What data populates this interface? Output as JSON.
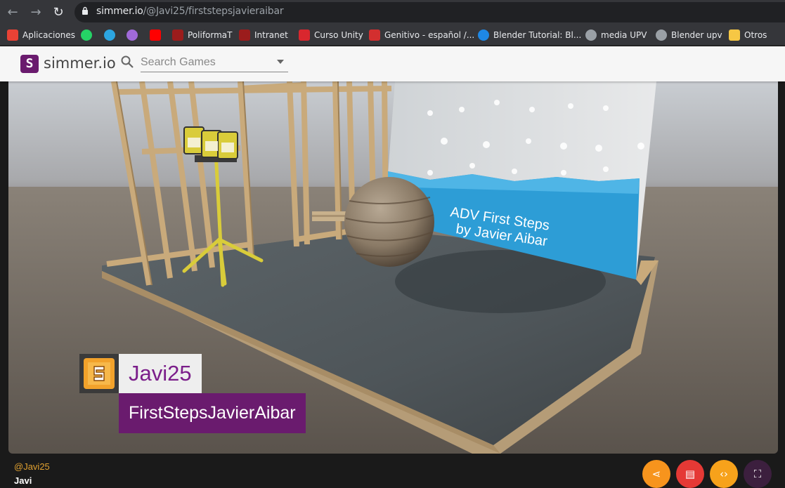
{
  "browser": {
    "url_host": "simmer.io",
    "url_path": "/@Javi25/firststepsjavieraibar",
    "bookmarks": [
      {
        "label": "Aplicaciones",
        "icon": "apps-grid-icon",
        "color": "#e94235"
      },
      {
        "label": "",
        "icon": "whatsapp-icon",
        "color": "#25d366"
      },
      {
        "label": "",
        "icon": "telegram-icon",
        "color": "#2ca5e0"
      },
      {
        "label": "",
        "icon": "podcast-icon",
        "color": "#a06ad9"
      },
      {
        "label": "",
        "icon": "youtube-icon",
        "color": "#ff0000"
      },
      {
        "label": "PoliformaT",
        "icon": "upv-icon",
        "color": "#9b1c1c"
      },
      {
        "label": "Intranet",
        "icon": "upv-icon",
        "color": "#9b1c1c"
      },
      {
        "label": "Curso Unity",
        "icon": "mega-icon",
        "color": "#d9272e"
      },
      {
        "label": "Genitivo - español /...",
        "icon": "fifty-icon",
        "color": "#d32f2f"
      },
      {
        "label": "Blender Tutorial: Bl...",
        "icon": "blender-icon",
        "color": "#1e88e5"
      },
      {
        "label": "media UPV",
        "icon": "globe-icon",
        "color": "#9aa0a6"
      },
      {
        "label": "Blender upv",
        "icon": "globe-icon",
        "color": "#9aa0a6"
      },
      {
        "label": "Otros",
        "icon": "folder-icon",
        "color": "#f6c744"
      }
    ]
  },
  "site": {
    "logo_letter": "S",
    "logo_text": "simmer.io",
    "search_placeholder": "Search Games"
  },
  "game": {
    "author": "Javi25",
    "title": "FirstStepsJavierAibar",
    "scene_text_line1": "ADV First Steps",
    "scene_text_line2": "by Javier Aibar"
  },
  "footer": {
    "handle": "@Javi25",
    "name": "Javi",
    "actions": [
      {
        "name": "share-button",
        "icon": "share-icon",
        "glyph": "⋖",
        "color": "#f7941d"
      },
      {
        "name": "report-button",
        "icon": "clipboard-icon",
        "glyph": "▤",
        "color": "#e53935"
      },
      {
        "name": "embed-button",
        "icon": "code-icon",
        "glyph": "‹›",
        "color": "#f7a21b"
      },
      {
        "name": "fullscreen-button",
        "icon": "fullscreen-icon",
        "glyph": "⛶",
        "color": "#3c1f3e"
      }
    ]
  }
}
